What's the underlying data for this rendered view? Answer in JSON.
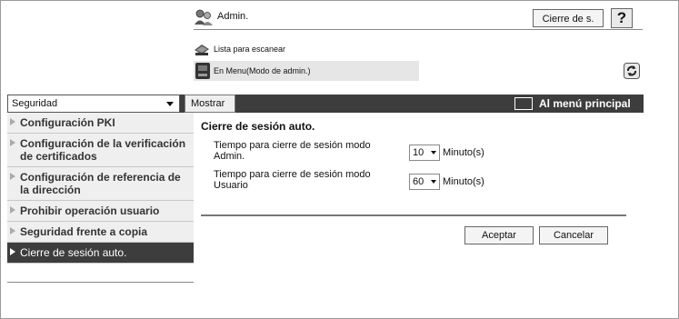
{
  "header": {
    "admin_label": "Admin.",
    "logout_label": "Cierre de s.",
    "help_label": "?",
    "scan_list_label": "Lista para escanear",
    "mode_label": "En Menu(Modo de admin.)"
  },
  "toolbar": {
    "section_value": "Seguridad",
    "show_label": "Mostrar",
    "main_menu_label": "Al menú principal"
  },
  "sidebar": {
    "items": [
      {
        "label": "Configuración PKI"
      },
      {
        "label": "Configuración de la verificación de certificados"
      },
      {
        "label": "Configuración de referencia de la dirección"
      },
      {
        "label": "Prohibir operación usuario"
      },
      {
        "label": "Seguridad frente a copia"
      },
      {
        "label": "Cierre de sesión auto."
      }
    ]
  },
  "main": {
    "title": "Cierre de sesión auto.",
    "fields": [
      {
        "label": "Tiempo para cierre de sesión modo Admin.",
        "value": "10",
        "unit": "Minuto(s)"
      },
      {
        "label": "Tiempo para cierre de sesión modo Usuario",
        "value": "60",
        "unit": "Minuto(s)"
      }
    ],
    "accept_label": "Aceptar",
    "cancel_label": "Cancelar"
  },
  "icons": {
    "admin": "admin-users-icon",
    "scan": "scanner-icon",
    "mode": "printer-icon",
    "refresh": "refresh-icon",
    "menu": "menu-screen-icon"
  },
  "colors": {
    "bar": "#3d3d3d",
    "sidebar_bg": "#efefef",
    "active_item": "#3d3d3d"
  }
}
